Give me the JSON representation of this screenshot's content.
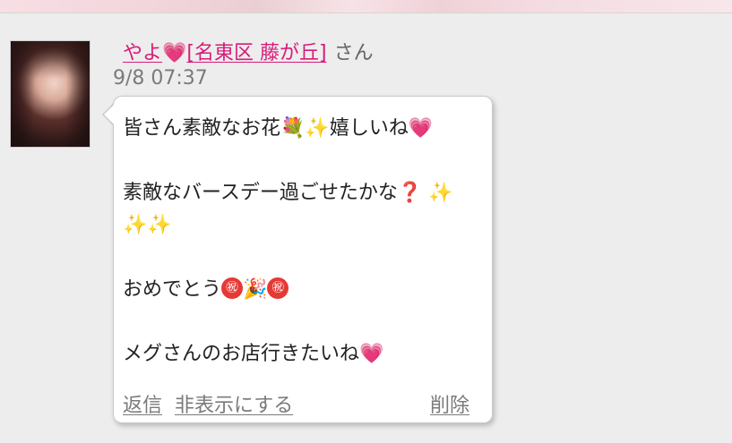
{
  "comment": {
    "username": "やよ",
    "username_heart": "💗",
    "area": "[名東区 藤が丘]",
    "honorific": "さん",
    "timestamp": "9/8 07:37",
    "message": {
      "line1_text": "皆さん素敵なお花",
      "line1_emoji_bouquet": "💐",
      "line1_emoji_sparkle": "✨",
      "line1_text2": "嬉しいね",
      "line1_emoji_heart": "💗",
      "line2_text": "素敵なバースデー過ごせたかな",
      "line2_emoji_question": "❓",
      "line2_emoji_sparkle": "✨",
      "line3_emoji_sparkles": "✨✨",
      "line4_text": "おめでとう",
      "line4_emoji_congrats1": "㊗",
      "line4_emoji_party": "🎉",
      "line4_emoji_congrats2": "㊗",
      "line5_text": "メグさんのお店行きたいね",
      "line5_emoji_heart": "💗"
    },
    "actions": {
      "reply": "返信",
      "hide": "非表示にする",
      "delete": "削除"
    }
  }
}
